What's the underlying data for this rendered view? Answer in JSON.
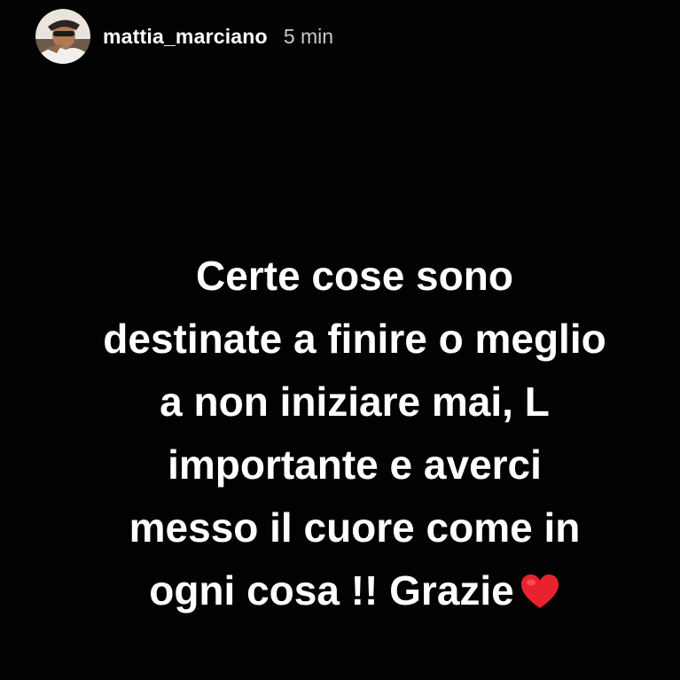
{
  "story": {
    "username": "mattia_marciano",
    "time": "5 min",
    "message_lines": [
      "Certe cose sono",
      "destinate a finire o meglio",
      "a non iniziare mai, L",
      "importante e averci",
      "messo il cuore come in",
      "ogni cosa !! Grazie"
    ],
    "emoji": "red-heart-icon",
    "colors": {
      "background": "#020202",
      "text": "#ffffff",
      "time": "#c9c9c9",
      "heart": "#e8222e"
    }
  }
}
